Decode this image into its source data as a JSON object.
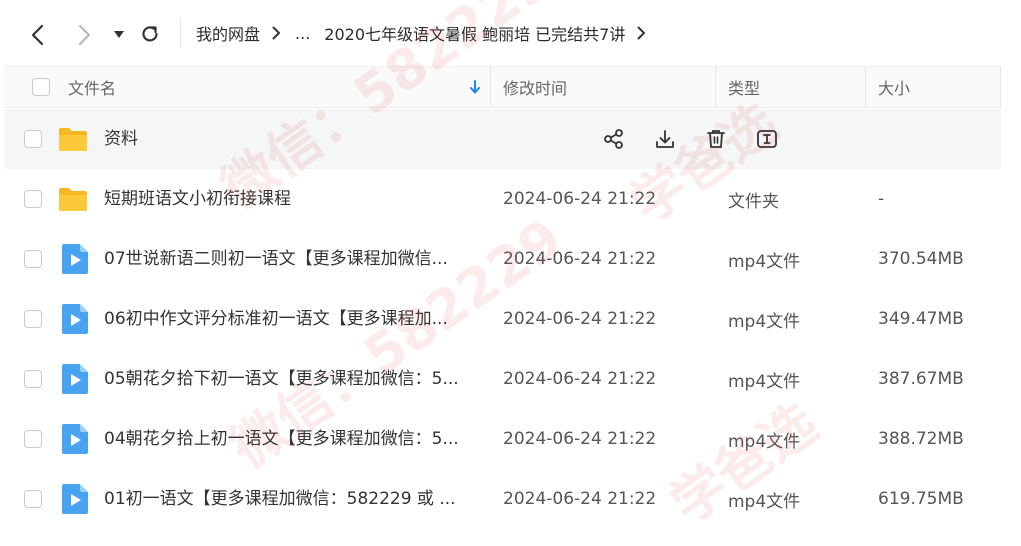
{
  "toolbar": {
    "back_icon": "chevron-left-icon",
    "forward_icon": "chevron-right-icon",
    "dropdown_icon": "caret-down-icon",
    "refresh_icon": "refresh-icon"
  },
  "breadcrumb": {
    "root": "我的网盘",
    "ellipsis": "...",
    "current": "2020七年级语文暑假 鲍丽培 已完结共7讲"
  },
  "columns": {
    "name": "文件名",
    "modified": "修改时间",
    "type": "类型",
    "size": "大小"
  },
  "colors": {
    "accent": "#1e88e5",
    "folder": "#fbc531",
    "video": "#4aa3f0"
  },
  "rows": [
    {
      "kind": "folder",
      "name": "资料",
      "date": "",
      "type": "",
      "size": "",
      "hover": true
    },
    {
      "kind": "folder",
      "name": "短期班语文小初衔接课程",
      "date": "2024-06-24 21:22",
      "type": "文件夹",
      "size": "-"
    },
    {
      "kind": "video",
      "name": "07世说新语二则初一语文【更多课程加微信...",
      "date": "2024-06-24 21:22",
      "type": "mp4文件",
      "size": "370.54MB"
    },
    {
      "kind": "video",
      "name": "06初中作文评分标准初一语文【更多课程加...",
      "date": "2024-06-24 21:22",
      "type": "mp4文件",
      "size": "349.47MB"
    },
    {
      "kind": "video",
      "name": "05朝花夕拾下初一语文【更多课程加微信：5...",
      "date": "2024-06-24 21:22",
      "type": "mp4文件",
      "size": "387.67MB"
    },
    {
      "kind": "video",
      "name": "04朝花夕拾上初一语文【更多课程加微信：5...",
      "date": "2024-06-24 21:22",
      "type": "mp4文件",
      "size": "388.72MB"
    },
    {
      "kind": "video",
      "name": "01初一语文【更多课程加微信：582229 或 ...",
      "date": "2024-06-24 21:22",
      "type": "mp4文件",
      "size": "619.75MB"
    }
  ],
  "hover_actions": [
    "share-icon",
    "download-icon",
    "delete-icon",
    "rename-icon"
  ],
  "watermark": {
    "wechat": "微信：",
    "number": "582229",
    "brand": "学爸选"
  }
}
